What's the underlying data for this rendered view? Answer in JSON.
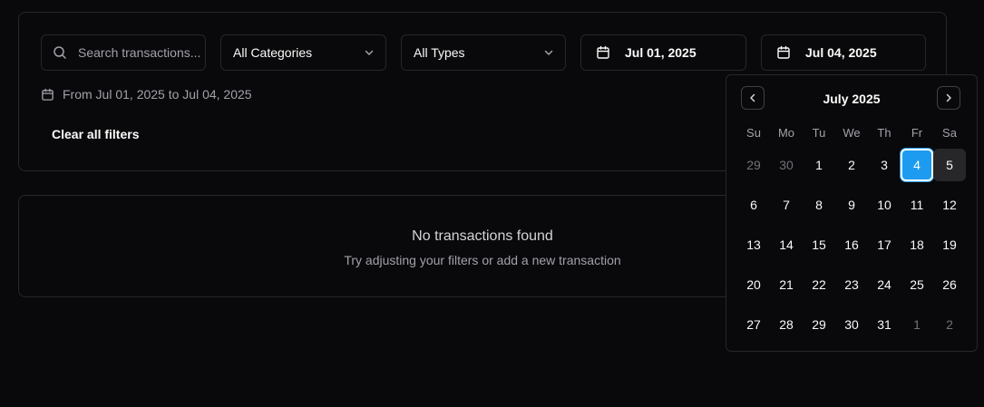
{
  "filters": {
    "search_placeholder": "Search transactions...",
    "category": "All Categories",
    "type": "All Types",
    "date_from": "Jul 01, 2025",
    "date_to": "Jul 04, 2025",
    "range_text": "From Jul 01, 2025 to Jul 04, 2025",
    "clear_label": "Clear all filters"
  },
  "empty": {
    "title": "No transactions found",
    "subtitle": "Try adjusting your filters or add a new transaction"
  },
  "calendar": {
    "month": "July 2025",
    "weekdays": [
      "Su",
      "Mo",
      "Tu",
      "We",
      "Th",
      "Fr",
      "Sa"
    ],
    "weeks": [
      [
        "29",
        "30",
        "1",
        "2",
        "3",
        "4",
        "5"
      ],
      [
        "6",
        "7",
        "8",
        "9",
        "10",
        "11",
        "12"
      ],
      [
        "13",
        "14",
        "15",
        "16",
        "17",
        "18",
        "19"
      ],
      [
        "20",
        "21",
        "22",
        "23",
        "24",
        "25",
        "26"
      ],
      [
        "27",
        "28",
        "29",
        "30",
        "31",
        "1",
        "2"
      ]
    ],
    "selected_day": "4",
    "colors": {
      "accent": "#1d9bf0",
      "background": "#09090b",
      "border": "#27272a"
    }
  }
}
